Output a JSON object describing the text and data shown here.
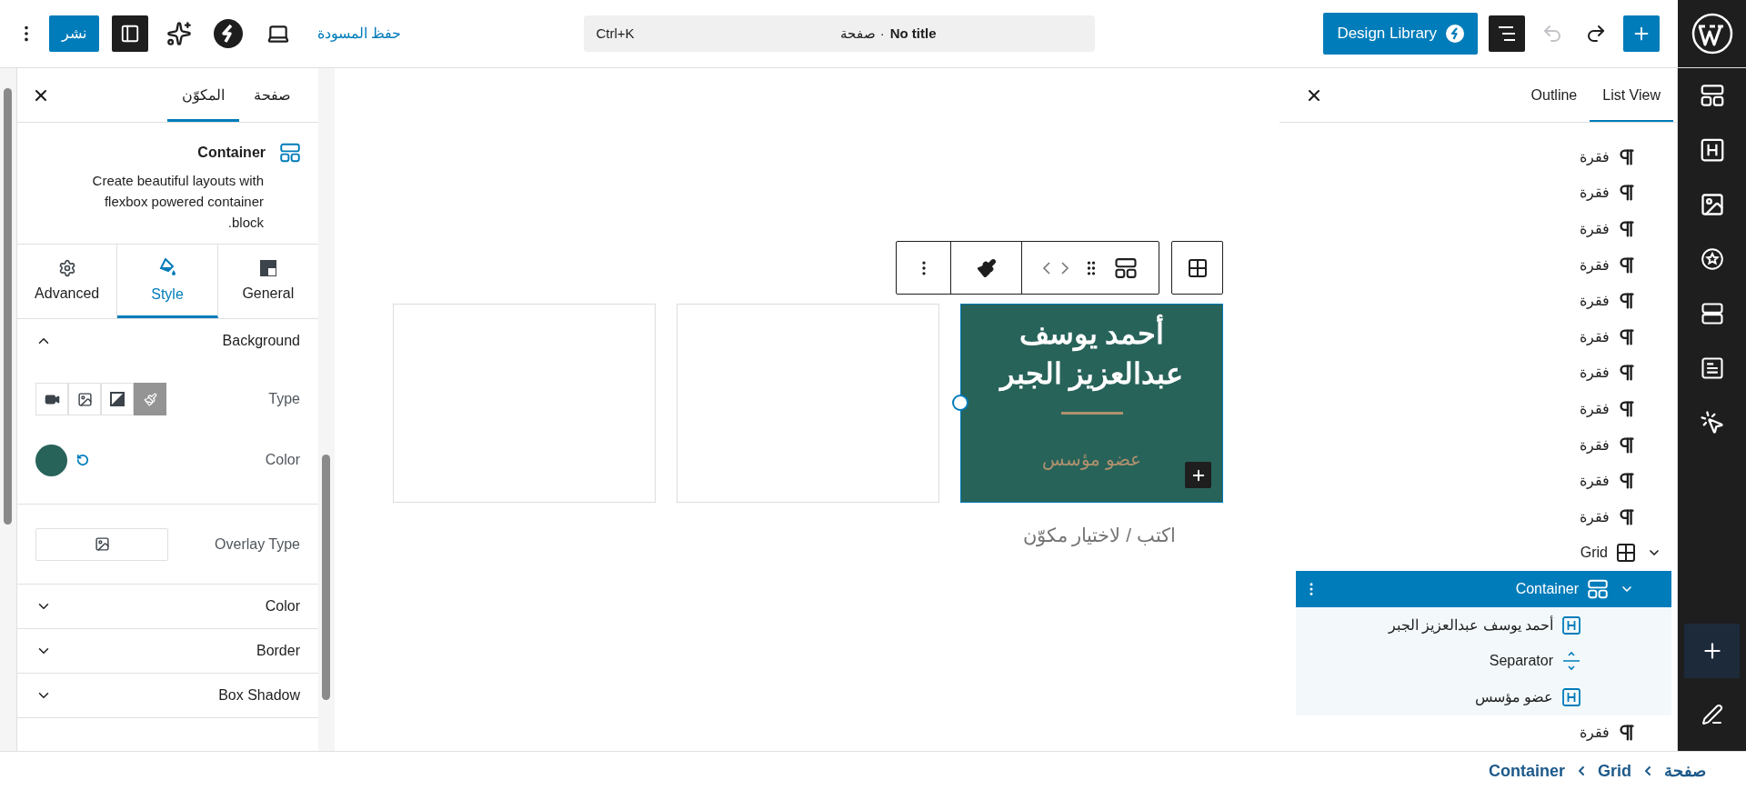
{
  "top_bar": {
    "publish_button": "نشر",
    "save_draft_link": "حفظ المسودة",
    "command_bar": {
      "title": "No title",
      "context": "· صفحة",
      "shortcut": "Ctrl+K"
    },
    "design_library_button": "Design Library",
    "undo": {
      "disabled": true
    },
    "redo": {
      "disabled": false
    }
  },
  "settings_sidebar": {
    "tabs": [
      {
        "label": "صفحة",
        "selected": false
      },
      {
        "label": "المكوّن",
        "selected": true
      }
    ],
    "block": {
      "title": "Container",
      "description": "Create beautiful layouts with flexbox powered container block."
    },
    "inspector_tabs": [
      {
        "kind": "general",
        "label": "General",
        "selected": false
      },
      {
        "kind": "style",
        "label": "Style",
        "selected": true
      },
      {
        "kind": "advanced",
        "label": "Advanced",
        "selected": false
      }
    ],
    "panels": [
      {
        "title": "Background",
        "expanded": true
      },
      {
        "title": "Color",
        "expanded": false
      },
      {
        "title": "Border",
        "expanded": false
      },
      {
        "title": "Box Shadow",
        "expanded": false
      }
    ],
    "background": {
      "type_label": "Type",
      "types": [
        {
          "kind": "color",
          "selected": true
        },
        {
          "kind": "gradient",
          "selected": false
        },
        {
          "kind": "image",
          "selected": false
        },
        {
          "kind": "video",
          "selected": false
        }
      ],
      "color_label": "Color",
      "color": "#28635a",
      "overlay_label": "Overlay Type"
    }
  },
  "canvas": {
    "columns": [
      {
        "kind": "profile",
        "heading": "أحمد يوسف عبدالعزيز الجبر",
        "subtitle": "عضو مؤسس",
        "color": "#28635a",
        "selected": true
      },
      {
        "kind": "empty",
        "selected": false
      },
      {
        "kind": "empty",
        "selected": false
      }
    ],
    "appender_placeholder": "اكتب / لاختيار مكوّن"
  },
  "list_view": {
    "tabs": [
      {
        "label": "List View",
        "selected": true
      },
      {
        "label": "Outline",
        "selected": false
      }
    ],
    "items": [
      {
        "kind": "paragraph",
        "label": "فقرة",
        "selected": false
      },
      {
        "kind": "paragraph",
        "label": "فقرة",
        "selected": false
      },
      {
        "kind": "paragraph",
        "label": "فقرة",
        "selected": false
      },
      {
        "kind": "paragraph",
        "label": "فقرة",
        "selected": false
      },
      {
        "kind": "paragraph",
        "label": "فقرة",
        "selected": false
      },
      {
        "kind": "paragraph",
        "label": "فقرة",
        "selected": false
      },
      {
        "kind": "paragraph",
        "label": "فقرة",
        "selected": false
      },
      {
        "kind": "paragraph",
        "label": "فقرة",
        "selected": false
      },
      {
        "kind": "paragraph",
        "label": "فقرة",
        "selected": false
      },
      {
        "kind": "paragraph",
        "label": "فقرة",
        "selected": false
      },
      {
        "kind": "paragraph",
        "label": "فقرة",
        "selected": false
      },
      {
        "kind": "grid",
        "label": "Grid",
        "selected": false,
        "expanded": true,
        "children": [
          {
            "kind": "container",
            "label": "Container",
            "selected": true,
            "expanded": true,
            "children": [
              {
                "kind": "heading",
                "label": "أحمد يوسف عبدالعزيز الجبر",
                "selected": false
              },
              {
                "kind": "separator",
                "label": "Separator",
                "selected": false
              },
              {
                "kind": "heading",
                "label": "عضو مؤسس",
                "selected": false
              }
            ]
          }
        ]
      },
      {
        "kind": "paragraph",
        "label": "فقرة",
        "selected": false
      }
    ]
  },
  "breadcrumbs": [
    "صفحة",
    "Grid",
    "Container"
  ]
}
